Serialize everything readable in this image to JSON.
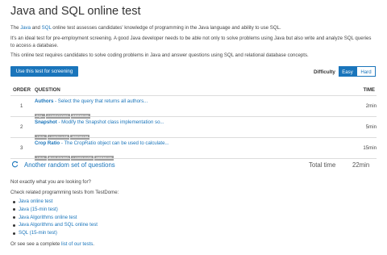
{
  "title": "Java and SQL online test",
  "intro": {
    "p1_pre": "The ",
    "p1_link1": "Java",
    "p1_mid": " and ",
    "p1_link2": "SQL",
    "p1_post": " online test assesses candidates' knowledge of programming in the Java language and ability to use SQL.",
    "p2": "It's an ideal test for pre-employment screening. A good Java developer needs to be able not only to solve problems using Java but also write and analyze SQL queries to access a database.",
    "p3": "This online test requires candidates to solve coding problems in Java and answer questions using SQL and relational database concepts."
  },
  "cta_label": "Use this test for screening",
  "difficulty": {
    "label": "Difficulty",
    "options": [
      "Easy",
      "Hard"
    ],
    "selected": "Easy"
  },
  "table": {
    "headers": {
      "order": "ORDER",
      "question": "QUESTION",
      "time": "TIME"
    },
    "rows": [
      {
        "order": "1",
        "name": "Authors",
        "desc": " - Select the query that returns all authors...",
        "tags": [
          "SQL",
          "CONDITIONS",
          "PREMIUM"
        ],
        "time": "2min"
      },
      {
        "order": "2",
        "name": "Snapshot",
        "desc": " - Modify the Snapshot class implementation so...",
        "tags": [
          "JAVA",
          "LANGUAGE",
          "PREMIUM"
        ],
        "time": "5min"
      },
      {
        "order": "3",
        "name": "Crop Ratio",
        "desc": " - The CropRatio object can be used to calculate...",
        "tags": [
          "JAVA",
          "BUG FIXING",
          "LANGUAGE",
          "PREMIUM"
        ],
        "time": "15min"
      }
    ]
  },
  "another_label": "Another random set of questions",
  "total": {
    "label": "Total time",
    "value": "22min"
  },
  "not_exactly": "Not exactly what you are looking for?",
  "check_related": "Check related programming tests from TestDome:",
  "related": [
    "Java online test",
    "Java (15-min test)",
    "Java Algorithms online test",
    "Java Algorithms and SQL online test",
    "SQL (15-min test)"
  ],
  "footer": {
    "pre": "Or see see a complete ",
    "link": "list of our tests",
    "post": "."
  },
  "colors": {
    "accent": "#1a75bb",
    "tag": "#9e9e9e"
  },
  "icons": {
    "refresh": "refresh-icon"
  }
}
